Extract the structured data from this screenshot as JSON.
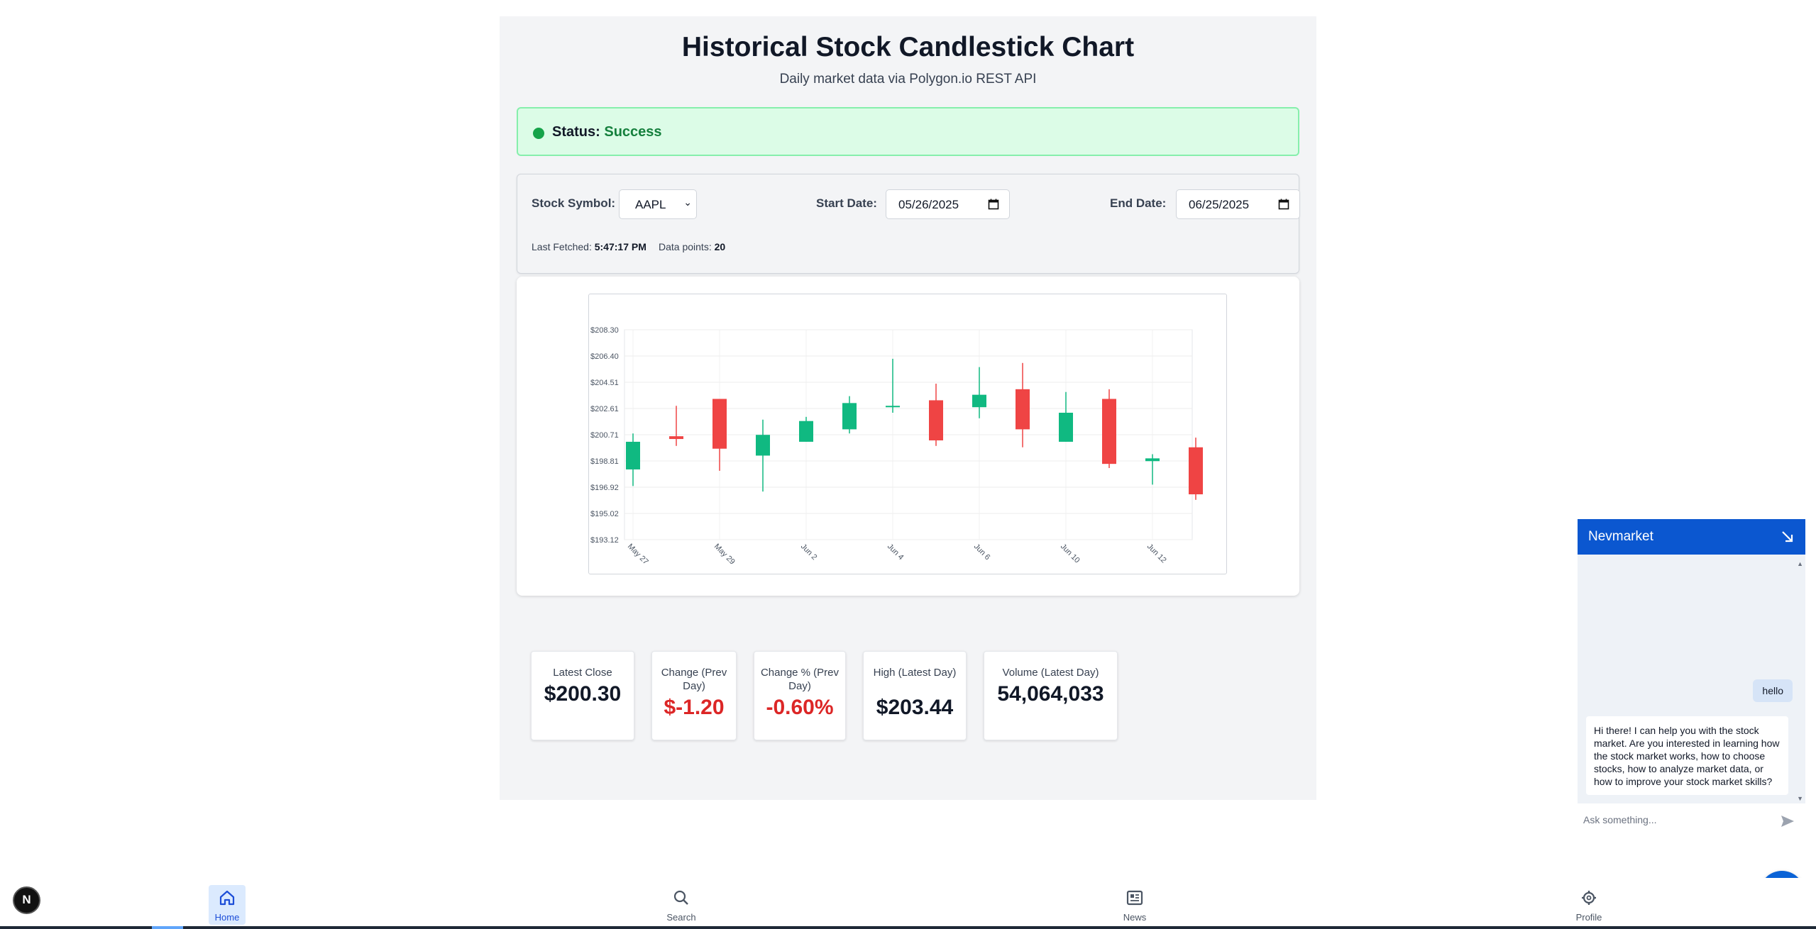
{
  "page": {
    "title": "Historical Stock Candlestick Chart",
    "subtitle": "Daily market data via Polygon.io REST API"
  },
  "status": {
    "label": "Status:",
    "value": "Success",
    "color": "#16a34a"
  },
  "controls": {
    "symbol_label": "Stock Symbol:",
    "symbol_value": "AAPL",
    "start_label": "Start Date:",
    "start_value": "05/26/2025",
    "end_label": "End Date:",
    "end_value": "06/25/2025",
    "last_fetched_label": "Last Fetched:",
    "last_fetched_value": "5:47:17 PM",
    "data_points_label": "Data points:",
    "data_points_value": "20"
  },
  "chart_data": {
    "type": "candlestick",
    "y_ticks": [
      "$208.30",
      "$206.40",
      "$204.51",
      "$202.61",
      "$200.71",
      "$198.81",
      "$196.92",
      "$195.02",
      "$193.12"
    ],
    "ylim": [
      193.12,
      208.3
    ],
    "x_ticks": [
      "May 27",
      "May 29",
      "Jun 2",
      "Jun 4",
      "Jun 6",
      "Jun 10",
      "Jun 12"
    ],
    "up_color": "#10b981",
    "down_color": "#ef4444",
    "candles": [
      {
        "date": "May 27",
        "open": 198.2,
        "high": 200.8,
        "low": 197.0,
        "close": 200.2
      },
      {
        "date": "May 28",
        "open": 200.6,
        "high": 202.8,
        "low": 199.9,
        "close": 200.4
      },
      {
        "date": "May 29",
        "open": 203.3,
        "high": 203.3,
        "low": 198.1,
        "close": 199.7
      },
      {
        "date": "May 30",
        "open": 199.2,
        "high": 201.8,
        "low": 196.6,
        "close": 200.7
      },
      {
        "date": "Jun 2",
        "open": 200.2,
        "high": 202.0,
        "low": 200.2,
        "close": 201.7
      },
      {
        "date": "Jun 3",
        "open": 201.1,
        "high": 203.5,
        "low": 200.8,
        "close": 203.0
      },
      {
        "date": "Jun 4",
        "open": 202.8,
        "high": 206.2,
        "low": 202.3,
        "close": 202.8
      },
      {
        "date": "Jun 5",
        "open": 203.2,
        "high": 204.4,
        "low": 199.9,
        "close": 200.3
      },
      {
        "date": "Jun 6",
        "open": 202.7,
        "high": 205.6,
        "low": 201.9,
        "close": 203.6
      },
      {
        "date": "Jun 9",
        "open": 204.0,
        "high": 205.9,
        "low": 199.8,
        "close": 201.1
      },
      {
        "date": "Jun 10",
        "open": 200.2,
        "high": 203.8,
        "low": 200.2,
        "close": 202.3
      },
      {
        "date": "Jun 11",
        "open": 203.3,
        "high": 204.0,
        "low": 198.3,
        "close": 198.6
      },
      {
        "date": "Jun 12",
        "open": 198.8,
        "high": 199.3,
        "low": 197.1,
        "close": 199.0
      },
      {
        "date": "Jun 13",
        "open": 199.8,
        "high": 200.5,
        "low": 196.0,
        "close": 196.4
      }
    ]
  },
  "stats": [
    {
      "label": "Latest Close",
      "value": "$200.30",
      "negative": false
    },
    {
      "label": "Change (Prev Day)",
      "value": "$-1.20",
      "negative": true
    },
    {
      "label": "Change % (Prev Day)",
      "value": "-0.60%",
      "negative": true
    },
    {
      "label": "High (Latest Day)",
      "value": "$203.44",
      "negative": false
    },
    {
      "label": "Volume (Latest Day)",
      "value": "54,064,033",
      "negative": false
    }
  ],
  "chat": {
    "title": "Nevmarket",
    "user_message": "hello",
    "bot_message": "Hi there! I can help you with the stock market. Are you interested in learning how the stock market works, how to choose stocks, how to analyze market data, or how to improve your stock market skills?",
    "input_placeholder": "Ask something...",
    "accent": "#0b57d0"
  },
  "nav": {
    "items": [
      {
        "label": "Home",
        "icon": "home-icon",
        "active": true
      },
      {
        "label": "Search",
        "icon": "search-icon",
        "active": false
      },
      {
        "label": "News",
        "icon": "news-icon",
        "active": false
      },
      {
        "label": "Profile",
        "icon": "gear-icon",
        "active": false
      }
    ]
  },
  "badge": {
    "letter": "N"
  },
  "fab": {
    "glyph": "✕"
  }
}
